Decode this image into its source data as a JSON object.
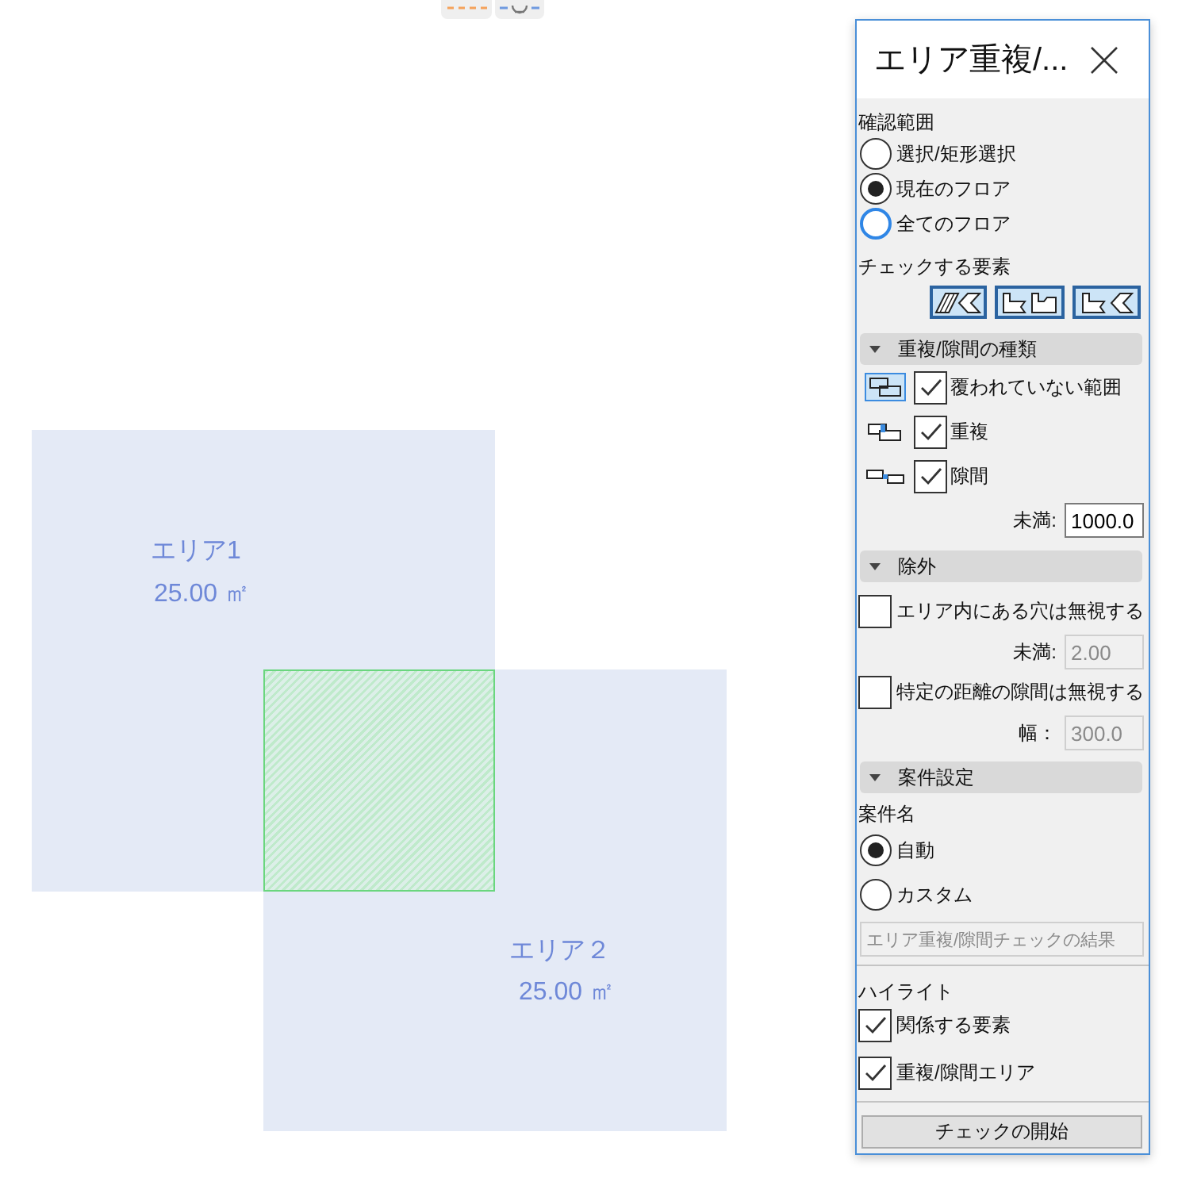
{
  "canvas": {
    "areas": [
      {
        "name": "エリア1",
        "area": "25.00 ㎡"
      },
      {
        "name": "エリア２",
        "area": "25.00 ㎡"
      }
    ]
  },
  "panel": {
    "title": "エリア重複/...",
    "scope": {
      "label": "確認範囲",
      "options": [
        {
          "label": "選択/矩形選択",
          "selected": false,
          "focused": false
        },
        {
          "label": "現在のフロア",
          "selected": true,
          "focused": false
        },
        {
          "label": "全てのフロア",
          "selected": false,
          "focused": true
        }
      ]
    },
    "elements": {
      "label": "チェックする要素",
      "toggles": [
        {
          "kind": "hatched",
          "selected": true
        },
        {
          "kind": "brackets",
          "selected": true
        },
        {
          "kind": "mixed",
          "selected": true
        }
      ]
    },
    "types": {
      "title": "重複/隙間の種類",
      "expanded": true,
      "items": [
        {
          "kind": "uncovered",
          "label": "覆われていない範囲",
          "checked": true,
          "selected": true
        },
        {
          "kind": "overlap",
          "label": "重複",
          "checked": true,
          "selected": false
        },
        {
          "kind": "gap",
          "label": "隙間",
          "checked": true,
          "selected": false
        }
      ],
      "limit": {
        "label": "未満:",
        "value": "1000.0",
        "disabled": false
      }
    },
    "exclude": {
      "title": "除外",
      "expanded": true,
      "items": [
        {
          "label": "エリア内にある穴は無視する",
          "checked": false,
          "field": {
            "label": "未満:",
            "value": "2.00",
            "disabled": true
          }
        },
        {
          "label": "特定の距離の隙間は無視する",
          "checked": false,
          "field": {
            "label": "幅：",
            "value": "300.0",
            "disabled": true
          }
        }
      ]
    },
    "settings": {
      "title": "案件設定",
      "expanded": true,
      "name_label": "案件名",
      "options": [
        {
          "label": "自動",
          "selected": true,
          "focused": false
        },
        {
          "label": "カスタム",
          "selected": false,
          "focused": false
        }
      ],
      "name_field": {
        "value": "エリア重複/隙間チェックの結果",
        "disabled": true
      }
    },
    "highlight": {
      "label": "ハイライト",
      "items": [
        {
          "label": "関係する要素",
          "checked": true
        },
        {
          "label": "重複/隙間エリア",
          "checked": true
        }
      ]
    },
    "start_button": "チェックの開始"
  }
}
